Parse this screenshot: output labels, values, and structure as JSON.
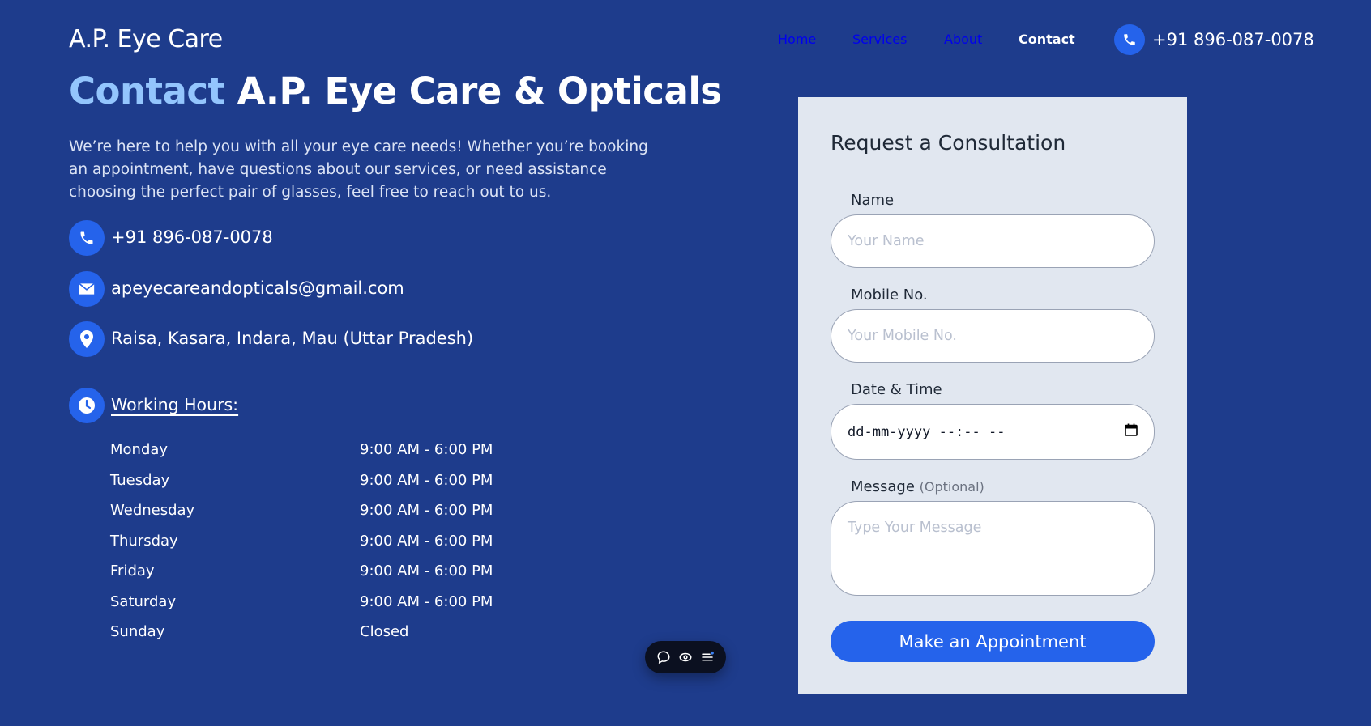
{
  "header": {
    "brand": "A.P. Eye Care",
    "nav": [
      {
        "label": "Home",
        "active": false
      },
      {
        "label": "Services",
        "active": false
      },
      {
        "label": "About",
        "active": false
      },
      {
        "label": "Contact",
        "active": true
      }
    ],
    "phone": "+91 896-087-0078"
  },
  "hero": {
    "title_accent": "Contact",
    "title_rest": "A.P. Eye Care & Opticals",
    "intro": "We’re here to help you with all your eye care needs! Whether you’re booking an appointment, have questions about our services, or need assistance choosing the perfect pair of glasses, feel free to reach out to us."
  },
  "contact": {
    "phone": "+91 896-087-0078",
    "email": "apeyecareandopticals@gmail.com",
    "address": "Raisa, Kasara, Indara, Mau (Uttar Pradesh)"
  },
  "hours": {
    "title": "Working Hours:",
    "rows": [
      {
        "day": "Monday",
        "time": "9:00 AM - 6:00 PM"
      },
      {
        "day": "Tuesday",
        "time": "9:00 AM - 6:00 PM"
      },
      {
        "day": "Wednesday",
        "time": "9:00 AM - 6:00 PM"
      },
      {
        "day": "Thursday",
        "time": "9:00 AM - 6:00 PM"
      },
      {
        "day": "Friday",
        "time": "9:00 AM - 6:00 PM"
      },
      {
        "day": "Saturday",
        "time": "9:00 AM - 6:00 PM"
      },
      {
        "day": "Sunday",
        "time": "Closed"
      }
    ]
  },
  "form": {
    "title": "Request a Consultation",
    "name_label": "Name",
    "name_placeholder": "Your Name",
    "mobile_label": "Mobile No.",
    "mobile_placeholder": "Your Mobile No.",
    "datetime_label": "Date & Time",
    "datetime_value": "dd-mm-yyyy --:-- --",
    "message_label": "Message",
    "message_optional": "(Optional)",
    "message_placeholder": "Type Your Message",
    "submit_label": "Make an Appointment"
  },
  "icons": {
    "phone": "phone-icon",
    "email": "envelope-icon",
    "address": "map-pin-icon",
    "hours": "clock-icon",
    "calendar": "calendar-icon",
    "toolbar": [
      "comment-icon",
      "eye-icon",
      "menu-icon"
    ]
  },
  "colors": {
    "background": "#1e3c8c",
    "accent": "#2563eb",
    "title_accent": "#93c5fd",
    "panel": "#e1e7f0"
  }
}
